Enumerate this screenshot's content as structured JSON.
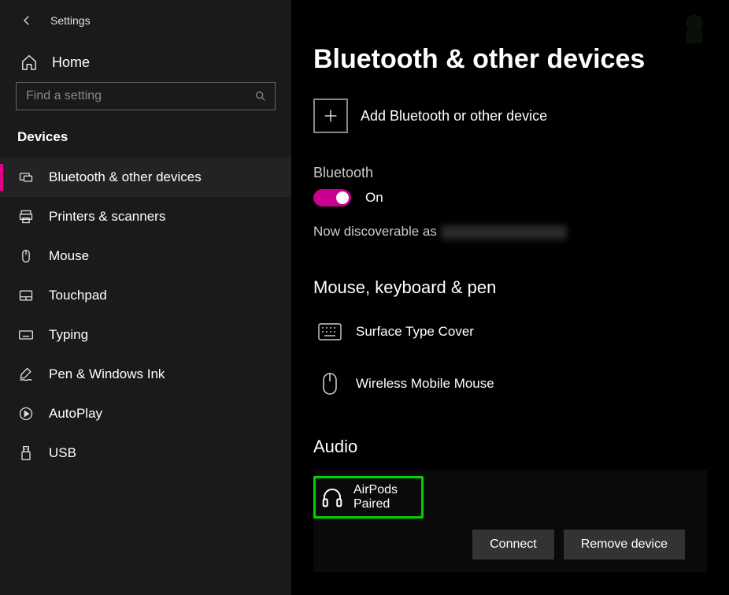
{
  "header": {
    "settings_label": "Settings",
    "home_label": "Home",
    "search_placeholder": "Find a setting",
    "section_label": "Devices"
  },
  "nav": {
    "items": [
      {
        "label": "Bluetooth & other devices",
        "icon": "bluetooth"
      },
      {
        "label": "Printers & scanners",
        "icon": "printer"
      },
      {
        "label": "Mouse",
        "icon": "mouse"
      },
      {
        "label": "Touchpad",
        "icon": "touchpad"
      },
      {
        "label": "Typing",
        "icon": "keyboard"
      },
      {
        "label": "Pen & Windows Ink",
        "icon": "pen"
      },
      {
        "label": "AutoPlay",
        "icon": "autoplay"
      },
      {
        "label": "USB",
        "icon": "usb"
      }
    ],
    "active_index": 0
  },
  "main": {
    "title": "Bluetooth & other devices",
    "add_device_label": "Add Bluetooth or other device",
    "bluetooth_heading": "Bluetooth",
    "toggle_state_label": "On",
    "discoverable_prefix": "Now discoverable as ",
    "section_mkp": "Mouse, keyboard & pen",
    "devices_mkp": [
      {
        "name": "Surface Type Cover",
        "icon": "keyboard"
      },
      {
        "name": "Wireless Mobile Mouse",
        "icon": "mouse"
      }
    ],
    "section_audio": "Audio",
    "audio_device": {
      "name": "AirPods",
      "status": "Paired"
    },
    "btn_connect": "Connect",
    "btn_remove": "Remove device"
  },
  "colors": {
    "accent": "#e3008c",
    "highlight_border": "#00d400"
  }
}
